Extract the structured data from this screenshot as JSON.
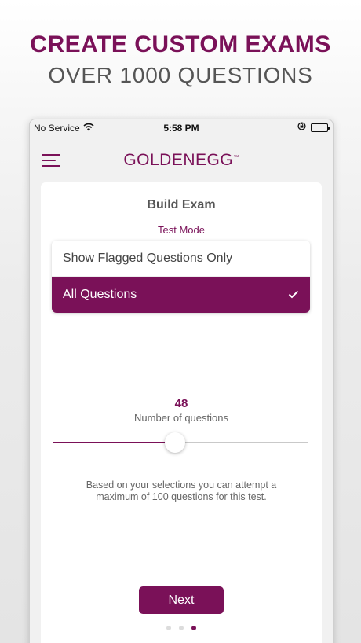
{
  "promo": {
    "headline": "CREATE CUSTOM EXAMS",
    "subheadline": "OVER 1000 QUESTIONS"
  },
  "status_bar": {
    "carrier": "No Service",
    "time": "5:58 PM",
    "icons": [
      "wifi-icon",
      "rotation-lock-icon",
      "battery-icon"
    ]
  },
  "nav": {
    "menu_icon": "hamburger-menu-icon",
    "logo_text": "GOLDENEGG",
    "logo_mark": "™"
  },
  "card": {
    "title": "Build Exam",
    "subtitle": "Test Mode",
    "options": [
      {
        "label": "Show Flagged Questions Only",
        "selected": false
      },
      {
        "label": "All Questions",
        "selected": true
      }
    ],
    "question_count": "48",
    "question_count_label": "Number of questions",
    "slider": {
      "value": 48,
      "max": 100
    },
    "info_text": "Based on your selections you can attempt a maximum of 100 questions for this test.",
    "next_label": "Next"
  },
  "pagination": {
    "total": 3,
    "active": 3
  },
  "colors": {
    "brand": "#7a1158",
    "text_gray": "#555555",
    "track_gray": "#c9c9c9"
  }
}
